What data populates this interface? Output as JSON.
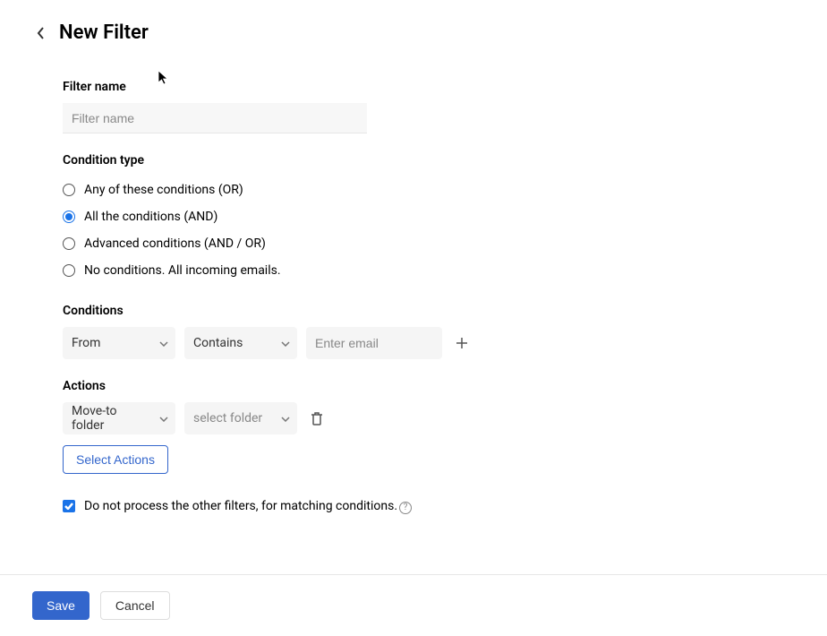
{
  "header": {
    "title": "New Filter"
  },
  "filterName": {
    "label": "Filter name",
    "placeholder": "Filter name",
    "value": ""
  },
  "conditionType": {
    "label": "Condition type",
    "options": [
      "Any of these conditions (OR)",
      "All the conditions (AND)",
      "Advanced conditions (AND / OR)",
      "No conditions. All incoming emails."
    ],
    "selected": 1
  },
  "conditions": {
    "label": "Conditions",
    "row": {
      "field": "From",
      "operator": "Contains",
      "emailPlaceholder": "Enter email",
      "emailValue": ""
    }
  },
  "actions": {
    "label": "Actions",
    "row": {
      "action": "Move-to folder",
      "targetPlaceholder": "select folder"
    },
    "selectActions": "Select Actions"
  },
  "checkbox": {
    "label": "Do not process the other filters, for matching conditions.",
    "checked": true
  },
  "footer": {
    "save": "Save",
    "cancel": "Cancel"
  }
}
